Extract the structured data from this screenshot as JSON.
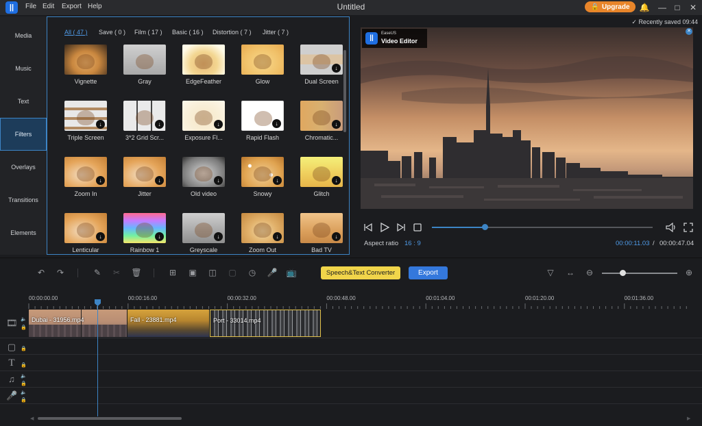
{
  "app": {
    "title": "Untitled",
    "logo_glyph": "||",
    "menu": [
      "File",
      "Edit",
      "Export",
      "Help"
    ],
    "upgrade_label": "Upgrade",
    "recently_saved": "Recently saved 09:44"
  },
  "sidebar": {
    "items": [
      {
        "label": "Media"
      },
      {
        "label": "Music"
      },
      {
        "label": "Text"
      },
      {
        "label": "Filters",
        "active": true
      },
      {
        "label": "Overlays"
      },
      {
        "label": "Transitions"
      },
      {
        "label": "Elements"
      }
    ]
  },
  "filters": {
    "tabs": [
      "All ( 47 )",
      "Save ( 0 )",
      "Film ( 17 )",
      "Basic ( 16 )",
      "Distortion ( 7 )",
      "Jitter ( 7 )"
    ],
    "active_tab": 0,
    "items": [
      {
        "label": "Vignette",
        "style": "vignette",
        "download": false
      },
      {
        "label": "Gray",
        "style": "gray",
        "download": false
      },
      {
        "label": "EdgeFeather",
        "style": "edgefeather",
        "download": false
      },
      {
        "label": "Glow",
        "style": "glow",
        "download": false
      },
      {
        "label": "Dual Screen",
        "style": "dual",
        "download": true
      },
      {
        "label": "Triple Screen",
        "style": "triple",
        "download": true
      },
      {
        "label": "3*2 Grid Scr...",
        "style": "grid",
        "download": true
      },
      {
        "label": "Exposure Fl...",
        "style": "exposure",
        "download": true
      },
      {
        "label": "Rapid Flash",
        "style": "rapid",
        "download": true
      },
      {
        "label": "Chromatic...",
        "style": "chromatic",
        "download": true
      },
      {
        "label": "Zoom In",
        "style": "normal",
        "download": true
      },
      {
        "label": "Jitter",
        "style": "normal",
        "download": true
      },
      {
        "label": "Old video",
        "style": "oldvideo",
        "download": true
      },
      {
        "label": "Snowy",
        "style": "snowy",
        "download": true
      },
      {
        "label": "Glitch",
        "style": "glitch",
        "download": true
      },
      {
        "label": "Lenticular",
        "style": "normal",
        "download": true
      },
      {
        "label": "Rainbow 1",
        "style": "rainbow",
        "download": true
      },
      {
        "label": "Greyscale",
        "style": "grey2",
        "download": true
      },
      {
        "label": "Zoom Out",
        "style": "zoomout",
        "download": true
      },
      {
        "label": "Bad TV",
        "style": "badtv",
        "download": true
      }
    ]
  },
  "preview": {
    "watermark_brand": "EaseUS",
    "watermark_product": "Video Editor",
    "aspect_label": "Aspect ratio",
    "aspect_value": "16 : 9",
    "current_time": "00:00:11.03",
    "separator": "/",
    "total_time": "00:00:47.04",
    "progress": 0.24
  },
  "toolbar": {
    "speech_label": "Speech&Text Converter",
    "export_label": "Export",
    "zoom_level": 0.27
  },
  "timeline": {
    "ticks": [
      "00:00:00.00",
      "00:00:16.00",
      "00:00:32.00",
      "00:00:48.00",
      "00:01:04.00",
      "00:01:20.00",
      "00:01:36.00"
    ],
    "clips": [
      {
        "label": "Dubai - 31956.mp4"
      },
      {
        "label": "Fall - 23881.mp4"
      },
      {
        "label": "Port - 33014.mp4"
      }
    ]
  },
  "colors": {
    "accent": "#3d85c6",
    "upgrade": "#e8852a",
    "speech_button": "#f1d54a",
    "export_button": "#3478dc"
  }
}
